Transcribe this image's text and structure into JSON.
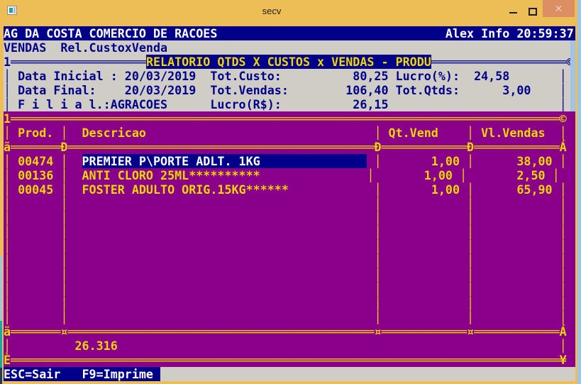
{
  "window": {
    "title": "secv"
  },
  "colors": {
    "navy": "#00008B",
    "gray": "#D0CDC7",
    "purple": "#8B008B",
    "yellow": "#EFD600",
    "lightblue": "#9EC4E6",
    "orange": "#EDBE55",
    "closebtn": "#DB8F63",
    "closex": "#F2CDB9",
    "teal": "#10ACAC",
    "deskblue": "#1F3864"
  },
  "chrome": {
    "minimize_label": "minimize",
    "maximize_label": "maximize",
    "close_label": "✕"
  },
  "terminal": {
    "rows": [
      {
        "name": "topbar-row",
        "style": "r-navy",
        "i": false,
        "segs": [
          {
            "t": "AG DA COSTA COMERCIO DE RACOES",
            "n": "company-name"
          },
          {
            "t": " ",
            "rep": 32
          },
          {
            "t": "Alex Info 20:59:37",
            "n": "user-and-clock"
          }
        ]
      },
      {
        "name": "menu-row",
        "style": "r-gray short",
        "i": false,
        "segs": [
          {
            "t": "VENDAS",
            "n": "menu-item-vendas",
            "i": true
          },
          {
            "t": " ",
            "rep": 2
          },
          {
            "t": "Rel.CustoxVenda",
            "n": "menu-item-rel-custoxvenda",
            "i": true
          },
          {
            "t": " ",
            "rep": 57
          }
        ]
      },
      {
        "name": "report-title-row",
        "style": "r-gray short",
        "i": false,
        "segs": [
          {
            "t": "1",
            "n": "border-corner-tl"
          },
          {
            "t": "═",
            "rep": 19,
            "n": "border-line"
          },
          {
            "t": "RELATORIO QTDS X CUSTOS x VENDAS - PRODU",
            "c": "hl-title",
            "n": "report-title"
          },
          {
            "t": "═",
            "rep": 19,
            "n": "border-line"
          },
          {
            "t": "©",
            "n": "border-corner-tr"
          }
        ]
      },
      {
        "name": "filter-row-data-inicial",
        "style": "r-gray short",
        "i": false,
        "segs": [
          {
            "t": "│ "
          },
          {
            "t": "Data Inicial : ",
            "n": "label-data-inicial"
          },
          {
            "t": "20/03/2019",
            "n": "value-data-inicial"
          },
          {
            "t": " ",
            "rep": 2
          },
          {
            "t": "Tot.Custo:",
            "n": "label-tot-custo"
          },
          {
            "t": " ",
            "rep": 10
          },
          {
            "t": "80,25",
            "n": "value-tot-custo"
          },
          {
            "t": " "
          },
          {
            "t": "Lucro(%):",
            "n": "label-lucro-pct"
          },
          {
            "t": " ",
            "rep": 2
          },
          {
            "t": "24,58",
            "n": "value-lucro-pct"
          },
          {
            "t": " ",
            "rep": 7
          },
          {
            "t": "│ "
          }
        ]
      },
      {
        "name": "filter-row-data-final",
        "style": "r-gray short",
        "i": false,
        "segs": [
          {
            "t": "│ "
          },
          {
            "t": "Data Final:",
            "n": "label-data-final"
          },
          {
            "t": " ",
            "rep": 4
          },
          {
            "t": "20/03/2019",
            "n": "value-data-final"
          },
          {
            "t": " ",
            "rep": 2
          },
          {
            "t": "Tot.Vendas:",
            "n": "label-tot-vendas"
          },
          {
            "t": " ",
            "rep": 8
          },
          {
            "t": "106,40",
            "n": "value-tot-vendas"
          },
          {
            "t": " "
          },
          {
            "t": "Tot.Qtds:",
            "n": "label-tot-qtds"
          },
          {
            "t": " ",
            "rep": 6
          },
          {
            "t": "3,00",
            "n": "value-tot-qtds"
          },
          {
            "t": " ",
            "rep": 4
          },
          {
            "t": "│ "
          }
        ]
      },
      {
        "name": "filter-row-filial",
        "style": "r-gray short",
        "i": false,
        "segs": [
          {
            "t": "│ "
          },
          {
            "t": "F i l i a l.:",
            "n": "label-filial"
          },
          {
            "t": "AGRACOES",
            "n": "value-filial"
          },
          {
            "t": " ",
            "rep": 6
          },
          {
            "t": "Lucro(R$):",
            "n": "label-lucro-rs"
          },
          {
            "t": " ",
            "rep": 10
          },
          {
            "t": "26,15",
            "n": "value-lucro-rs"
          },
          {
            "t": " ",
            "rep": 24
          },
          {
            "t": "│ "
          }
        ]
      },
      {
        "name": "table-top-border",
        "style": "r-purple",
        "i": false,
        "segs": [
          {
            "t": "1",
            "n": "border-corner-tl"
          },
          {
            "t": "═",
            "rep": 77,
            "n": "border-line"
          },
          {
            "t": "©",
            "n": "border-corner-tr"
          },
          {
            "t": " "
          }
        ]
      },
      {
        "name": "table-header-row",
        "style": "r-purple",
        "i": false,
        "segs": [
          {
            "t": "│ "
          },
          {
            "t": "Prod.",
            "n": "col-header-prod"
          },
          {
            "t": " "
          },
          {
            "t": "│"
          },
          {
            "t": " ",
            "rep": 2
          },
          {
            "t": "Descricao",
            "n": "col-header-descricao"
          },
          {
            "t": " ",
            "rep": 32
          },
          {
            "t": "│"
          },
          {
            "t": " "
          },
          {
            "t": "Qt.Vend",
            "n": "col-header-qt-vend"
          },
          {
            "t": " ",
            "rep": 4
          },
          {
            "t": "│"
          },
          {
            "t": " "
          },
          {
            "t": "Vl.Vendas",
            "n": "col-header-vl-vendas"
          },
          {
            "t": " ",
            "rep": 2
          },
          {
            "t": "│"
          },
          {
            "t": " "
          }
        ]
      },
      {
        "name": "table-header-separator",
        "style": "r-purple",
        "i": false,
        "segs": [
          {
            "t": "ã",
            "n": "border-tee-left"
          },
          {
            "t": "═",
            "rep": 7
          },
          {
            "t": "Ð",
            "n": "border-tee"
          },
          {
            "t": "═",
            "rep": 43
          },
          {
            "t": "Ð",
            "n": "border-tee"
          },
          {
            "t": "═",
            "rep": 12
          },
          {
            "t": "Ð",
            "n": "border-tee"
          },
          {
            "t": "═",
            "rep": 12
          },
          {
            "t": "Á",
            "n": "border-tee-right"
          },
          {
            "t": " "
          }
        ]
      },
      {
        "name": "product-row-selected",
        "style": "r-purple",
        "i": true,
        "segs": [
          {
            "t": "│ "
          },
          {
            "t": "00474",
            "n": "product-code"
          },
          {
            "t": " "
          },
          {
            "t": "│"
          },
          {
            "t": " ",
            "rep": 2
          },
          {
            "t": "PREMIER P\\PORTE ADLT. 1KG",
            "c": "hl-sel",
            "n": "product-desc-selected"
          },
          {
            "t": " ",
            "rep": 15,
            "c": "hl-sel"
          },
          {
            "t": " "
          },
          {
            "t": "│"
          },
          {
            "t": " ",
            "rep": 7
          },
          {
            "t": "1,00",
            "n": "qty-sold"
          },
          {
            "t": " "
          },
          {
            "t": "│"
          },
          {
            "t": " ",
            "rep": 6
          },
          {
            "t": "38,00",
            "n": "sales-value"
          },
          {
            "t": " "
          },
          {
            "t": "│"
          },
          {
            "t": " "
          }
        ]
      },
      {
        "name": "product-row",
        "style": "r-purple",
        "i": true,
        "segs": [
          {
            "t": "│ "
          },
          {
            "t": "00136",
            "n": "product-code"
          },
          {
            "t": " "
          },
          {
            "t": "│"
          },
          {
            "t": " ",
            "rep": 2
          },
          {
            "t": "ANTI CLORO 25ML**********",
            "n": "product-desc"
          },
          {
            "t": " ",
            "rep": 14
          },
          {
            "t": " "
          },
          {
            "t": "│"
          },
          {
            "t": " ",
            "rep": 7
          },
          {
            "t": "1,00",
            "n": "qty-sold"
          },
          {
            "t": " "
          },
          {
            "t": "│"
          },
          {
            "t": " ",
            "rep": 7
          },
          {
            "t": "2,50",
            "n": "sales-value"
          },
          {
            "t": " "
          },
          {
            "t": "│"
          },
          {
            "t": " "
          }
        ]
      },
      {
        "name": "product-row",
        "style": "r-purple",
        "i": true,
        "segs": [
          {
            "t": "│ "
          },
          {
            "t": "00045",
            "n": "product-code"
          },
          {
            "t": " "
          },
          {
            "t": "│"
          },
          {
            "t": " ",
            "rep": 2
          },
          {
            "t": "FOSTER ADULTO ORIG.15KG******",
            "n": "product-desc"
          },
          {
            "t": " ",
            "rep": 11
          },
          {
            "t": " "
          },
          {
            "t": "│"
          },
          {
            "t": " ",
            "rep": 7
          },
          {
            "t": "1,00",
            "n": "qty-sold"
          },
          {
            "t": " "
          },
          {
            "t": "│"
          },
          {
            "t": " ",
            "rep": 6
          },
          {
            "t": "65,90",
            "n": "sales-value"
          },
          {
            "t": " "
          },
          {
            "t": "│"
          },
          {
            "t": " "
          }
        ]
      },
      {
        "name": "table-empty-row",
        "style": "r-purple",
        "i": false,
        "repeat": 9,
        "segs": [
          {
            "t": "│"
          },
          {
            "t": " ",
            "rep": 7
          },
          {
            "t": "│"
          },
          {
            "t": " ",
            "rep": 43
          },
          {
            "t": "│"
          },
          {
            "t": " ",
            "rep": 12
          },
          {
            "t": "│"
          },
          {
            "t": " ",
            "rep": 12
          },
          {
            "t": "│"
          },
          {
            "t": " "
          }
        ]
      },
      {
        "name": "table-bottom-separator",
        "style": "r-purple",
        "i": false,
        "segs": [
          {
            "t": "ã",
            "n": "border-tee-left"
          },
          {
            "t": "═",
            "rep": 7
          },
          {
            "t": "¤",
            "n": "border-tee"
          },
          {
            "t": "═",
            "rep": 43
          },
          {
            "t": "¤",
            "n": "border-tee"
          },
          {
            "t": "═",
            "rep": 12
          },
          {
            "t": "¤",
            "n": "border-tee"
          },
          {
            "t": "═",
            "rep": 12
          },
          {
            "t": "Á",
            "n": "border-tee-right"
          },
          {
            "t": " "
          }
        ]
      },
      {
        "name": "total-row",
        "style": "r-purple",
        "i": false,
        "segs": [
          {
            "t": "│"
          },
          {
            "t": " ",
            "rep": 9
          },
          {
            "t": "26.316",
            "n": "record-count"
          },
          {
            "t": " ",
            "rep": 62
          },
          {
            "t": "│"
          },
          {
            "t": " "
          }
        ]
      },
      {
        "name": "table-bottom-border",
        "style": "r-purple",
        "i": false,
        "segs": [
          {
            "t": "È",
            "n": "border-corner-bl"
          },
          {
            "t": "═",
            "rep": 77,
            "n": "border-line"
          },
          {
            "t": "¥",
            "n": "border-corner-br"
          },
          {
            "t": " "
          }
        ]
      },
      {
        "name": "status-bar-row",
        "style": "r-gray",
        "i": false,
        "segs": [
          {
            "t": "ESC=Sair",
            "c": "hl-sel",
            "n": "hint-esc-sair"
          },
          {
            "t": " ",
            "rep": 3,
            "c": "hl-sel"
          },
          {
            "t": "F9=Imprime",
            "c": "hl-sel",
            "n": "hint-f9-imprime"
          },
          {
            "t": " ",
            "c": "hl-sel"
          },
          {
            "t": " ",
            "rep": 58
          }
        ]
      }
    ]
  }
}
